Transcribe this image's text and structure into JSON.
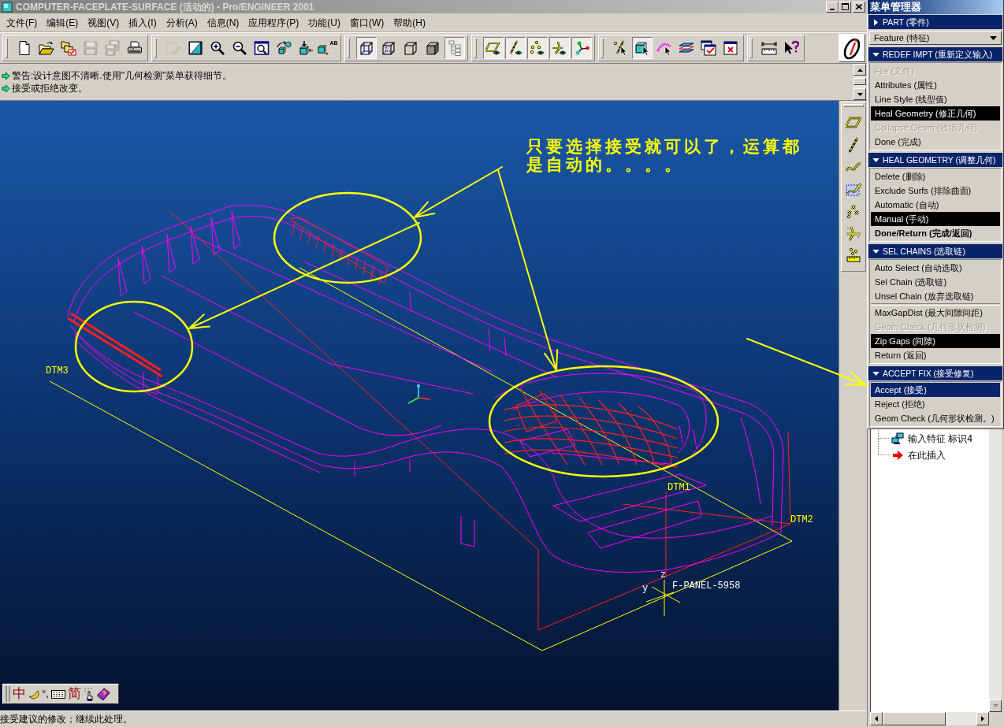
{
  "window": {
    "title": "COMPUTER-FACEPLATE-SURFACE (活动的) - Pro/ENGINEER 2001"
  },
  "menu_bar": [
    "文件(F)",
    "编辑(E)",
    "视图(V)",
    "插入(I)",
    "分析(A)",
    "信息(N)",
    "应用程序(P)",
    "功能(U)",
    "窗口(W)",
    "帮助(H)"
  ],
  "toolbar": [
    [
      {
        "kind": "new",
        "pressed": false,
        "disabled": false
      },
      {
        "kind": "open",
        "pressed": false,
        "disabled": false
      },
      {
        "kind": "folders",
        "pressed": false,
        "disabled": false
      },
      {
        "kind": "save",
        "pressed": false,
        "disabled": true
      },
      {
        "kind": "save_copy",
        "pressed": false,
        "disabled": true
      },
      {
        "kind": "print",
        "pressed": false,
        "disabled": false
      }
    ],
    [
      {
        "kind": "repaint",
        "pressed": false,
        "disabled": true
      },
      {
        "kind": "orient",
        "pressed": false,
        "disabled": false
      },
      {
        "kind": "zoom_in",
        "pressed": false,
        "disabled": false
      },
      {
        "kind": "zoom_out",
        "pressed": false,
        "disabled": false
      },
      {
        "kind": "refit",
        "pressed": false,
        "disabled": false
      },
      {
        "kind": "reorient",
        "pressed": false,
        "disabled": false
      },
      {
        "kind": "spin",
        "pressed": false,
        "disabled": false
      },
      {
        "kind": "saved_views",
        "label": "AB",
        "pressed": false,
        "disabled": false
      }
    ],
    [
      {
        "kind": "wireframe",
        "pressed": true,
        "disabled": false
      },
      {
        "kind": "hidden_line",
        "pressed": false,
        "disabled": false
      },
      {
        "kind": "no_hidden",
        "pressed": false,
        "disabled": false
      },
      {
        "kind": "shaded",
        "pressed": false,
        "disabled": false
      },
      {
        "kind": "model_tree",
        "pressed": true,
        "disabled": false
      }
    ],
    [
      {
        "kind": "datum_planes",
        "pressed": true,
        "disabled": false
      },
      {
        "kind": "datum_axes",
        "pressed": true,
        "disabled": false
      },
      {
        "kind": "datum_points",
        "pressed": true,
        "disabled": false
      },
      {
        "kind": "csys_display",
        "pressed": true,
        "disabled": false
      },
      {
        "kind": "spin_center",
        "pressed": true,
        "disabled": false
      }
    ],
    [
      {
        "kind": "select_filter",
        "pressed": false,
        "disabled": false
      },
      {
        "kind": "select",
        "pressed": true,
        "disabled": false
      },
      {
        "kind": "query",
        "pressed": false,
        "disabled": false
      },
      {
        "kind": "layers",
        "pressed": false,
        "disabled": false
      },
      {
        "kind": "activate_window",
        "pressed": false,
        "disabled": false
      },
      {
        "kind": "close_window",
        "pressed": false,
        "disabled": false
      }
    ],
    [
      {
        "kind": "measure",
        "pressed": false,
        "disabled": false
      },
      {
        "kind": "whats_this",
        "pressed": false,
        "disabled": false
      }
    ]
  ],
  "messages": [
    "警告:设计意图不清晰.使用\"几何检测\"菜单获得细节。",
    "接受或拒绝改变。"
  ],
  "graphics": {
    "annotation": "只要选择接受就可以了，运算都是自动的。。。。",
    "datum_labels": [
      {
        "label": "DTM3",
        "color": "#ffff00"
      },
      {
        "label": "DTM1",
        "color": "#ffff00"
      },
      {
        "label": "DTM2",
        "color": "#ffff00"
      }
    ],
    "csys": {
      "name": "F-PANEL-5958",
      "axis_labels": [
        "z",
        "y"
      ]
    }
  },
  "datum_toolbar": [
    {
      "kind": "plane_tool"
    },
    {
      "kind": "axis_tool"
    },
    {
      "kind": "curve_tool"
    },
    {
      "kind": "sketch_curve_tool"
    },
    {
      "kind": "point_tool"
    },
    {
      "kind": "csys_tool"
    },
    {
      "kind": "analysis_tool"
    }
  ],
  "ime_bar": {
    "mode": "中",
    "punctuation": "°,",
    "charset": "简"
  },
  "status_bar": "接受建议的修改；继续此处理。",
  "menu_manager": {
    "title": "菜单管理器",
    "sections": [
      {
        "title": "PART (零件)",
        "expanded": false,
        "current": "Feature (特征)"
      },
      {
        "title": "REDEF IMPT (重新定义输入)",
        "expanded": true,
        "groups": [
          [
            {
              "label": "File (文件)",
              "selected": false,
              "focused": false,
              "disabled": true,
              "default": false
            },
            {
              "label": "Attributes (属性)",
              "selected": false,
              "focused": false,
              "disabled": false,
              "default": false
            },
            {
              "label": "Line Style (线型值)",
              "selected": false,
              "focused": false,
              "disabled": false,
              "default": false
            },
            {
              "label": "Heal Geometry (修正几何)",
              "selected": true,
              "focused": false,
              "disabled": false,
              "default": false
            },
            {
              "label": "Collapse Geom (收缩几何)",
              "selected": false,
              "focused": false,
              "disabled": true,
              "default": false
            },
            {
              "label": "Done (完成)",
              "selected": false,
              "focused": false,
              "disabled": false,
              "default": false
            }
          ]
        ]
      },
      {
        "title": "HEAL GEOMETRY (调整几何)",
        "expanded": true,
        "groups": [
          [
            {
              "label": "Delete (删除)",
              "selected": false,
              "focused": false,
              "disabled": false,
              "default": false
            },
            {
              "label": "Exclude Surfs (排除曲面)",
              "selected": false,
              "focused": false,
              "disabled": false,
              "default": false
            },
            {
              "label": "Automatic (自动)",
              "selected": false,
              "focused": false,
              "disabled": false,
              "default": false
            },
            {
              "label": "Manual (手动)",
              "selected": true,
              "focused": false,
              "disabled": false,
              "default": false
            },
            {
              "label": "Done/Return (完成/返回)",
              "selected": false,
              "focused": false,
              "disabled": false,
              "default": true
            }
          ]
        ]
      },
      {
        "title": "SEL CHAINS (选取链)",
        "expanded": true,
        "groups": [
          [
            {
              "label": "Auto Select (自动选取)",
              "selected": false,
              "focused": false,
              "disabled": false,
              "default": false
            },
            {
              "label": "Sel Chain (选取链)",
              "selected": false,
              "focused": false,
              "disabled": false,
              "default": false
            },
            {
              "label": "Unsel Chain (放弃选取链)",
              "selected": false,
              "focused": false,
              "disabled": false,
              "default": false
            }
          ],
          [
            {
              "label": "MaxGapDist (最大间隙间距)",
              "selected": false,
              "focused": false,
              "disabled": false,
              "default": false
            },
            {
              "label": "Geom Check (几何形状检测)",
              "selected": false,
              "focused": false,
              "disabled": true,
              "default": false
            },
            {
              "label": "Zip Gaps (间隙)",
              "selected": true,
              "focused": false,
              "disabled": false,
              "default": false
            },
            {
              "label": "Return (返回)",
              "selected": false,
              "focused": false,
              "disabled": false,
              "default": false
            }
          ]
        ]
      },
      {
        "title": "ACCEPT FIX (接受修复)",
        "expanded": true,
        "groups": [
          [
            {
              "label": "Accept (接受)",
              "selected": false,
              "focused": true,
              "disabled": false,
              "default": false
            },
            {
              "label": "Reject (拒绝)",
              "selected": false,
              "focused": false,
              "disabled": false,
              "default": false
            },
            {
              "label": "Geom Check (几何形状检测。)",
              "selected": false,
              "focused": false,
              "disabled": false,
              "default": false
            }
          ]
        ]
      }
    ]
  },
  "model_tree": {
    "items": [
      {
        "label": "输入特征 标识4",
        "kind": "import_feature"
      },
      {
        "label": "在此插入",
        "kind": "insert_here"
      }
    ]
  }
}
